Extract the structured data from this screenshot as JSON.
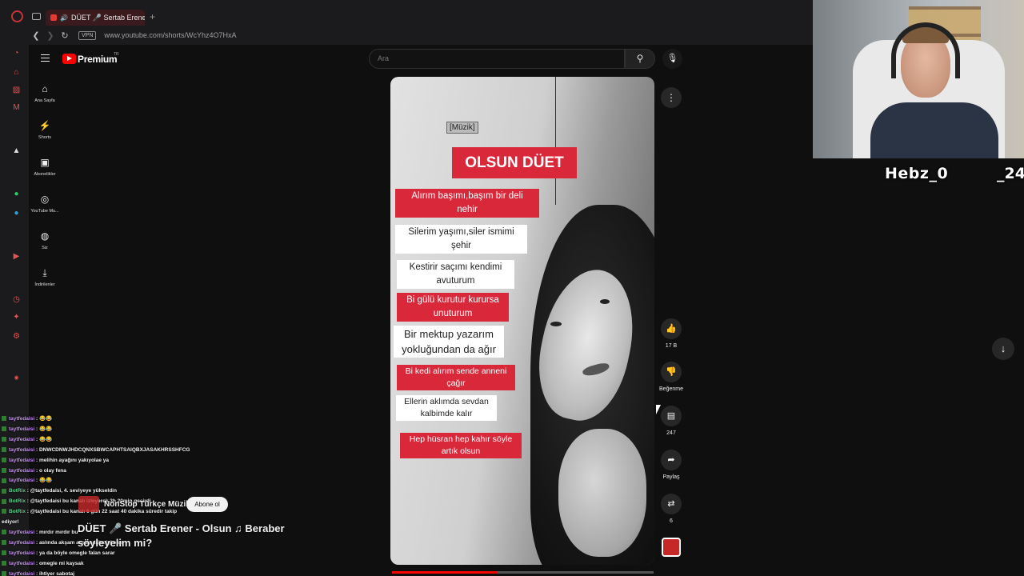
{
  "browser": {
    "tab_title": "DÜET 🎤 Sertab Erener",
    "new_tab_icon": "+",
    "vpn_label": "VPN",
    "url": "www.youtube.com/shorts/WcYhz4O7HxA"
  },
  "youtube": {
    "logo_text": "Premium",
    "region": "TR",
    "search_placeholder": "Ara",
    "nav": [
      {
        "label": "Ana Sayfa",
        "icon": "home-icon"
      },
      {
        "label": "Shorts",
        "icon": "shorts-icon"
      },
      {
        "label": "Abonelikler",
        "icon": "subscriptions-icon"
      },
      {
        "label": "YouTube Mu...",
        "icon": "youtube-music-icon"
      },
      {
        "label": "Siz",
        "icon": "you-icon"
      },
      {
        "label": "İndirilenler",
        "icon": "downloads-icon"
      }
    ]
  },
  "video": {
    "tag": "[Müzik]",
    "title_card": "OLSUN DÜET",
    "lyrics": [
      "Alırım başımı,başım bir deli nehir",
      "Silerim yaşımı,siler ismimi şehir",
      "Kestirir saçımı kendimi avuturum",
      "Bi gülü kurutur kurursa unuturum",
      "Bir mektup yazarım yokluğundan da ağır",
      "Bi kedi alırım sende anneni çağır",
      "Ellerin aklımda sevdan kalbimde kalır",
      "Hep hüsran hep kahır söyle artık olsun"
    ],
    "progress": 0.4
  },
  "actions": {
    "likes": "17 B",
    "dislike_label": "Beğenme",
    "comments": "247",
    "share_label": "Paylaş",
    "remix_count": "6"
  },
  "stream": {
    "streamer_name": "Hebz_0",
    "streamer_suffix": "_24"
  },
  "chat": [
    {
      "user": "taytfedaisi",
      "message": "😂😂",
      "bot": false
    },
    {
      "user": "taytfedaisi",
      "message": "😂😂",
      "bot": false
    },
    {
      "user": "taytfedaisi",
      "message": "😂😂",
      "bot": false
    },
    {
      "user": "taytfedaisi",
      "message": "DNWCDNWJHDCQNXSBWCAPHTSAIQBXJASAKHRSSHFCG",
      "bot": false
    },
    {
      "user": "taytfedaisi",
      "message": "melihin ayağını yakıyolae ya",
      "bot": false
    },
    {
      "user": "taytfedaisi",
      "message": "o olay fena",
      "bot": false
    },
    {
      "user": "taytfedaisi",
      "message": "😂😂",
      "bot": false
    },
    {
      "user": "BotRix",
      "message": "@taytfedaisi, 4. seviyeye yükseldin",
      "bot": true
    },
    {
      "user": "BotRix",
      "message": "@taytfedaisi bu kanalı izleyerek 3h 20min geçirdi",
      "bot": true
    },
    {
      "user": "BotRix",
      "message": "@taytfedaisi bu kanalı 6 gün 22 saat 40 dakika süredir takip",
      "bot": true
    },
    {
      "user": "",
      "message": "ediyor!",
      "bot": false
    },
    {
      "user": "taytfedaisi",
      "message": "mırdır mırdır bu",
      "bot": false
    },
    {
      "user": "taytfedaisi",
      "message": "aslında akşam acsan daha iyi olur",
      "bot": false
    },
    {
      "user": "taytfedaisi",
      "message": "ya da böyle omegle falan sarar",
      "bot": false
    },
    {
      "user": "taytfedaisi",
      "message": "omegle mi kaysak",
      "bot": false
    },
    {
      "user": "taytfedaisi",
      "message": "ihtiyer sabotaj",
      "bot": false
    }
  ],
  "short_info": {
    "channel": "NonStop Türkçe Müzik",
    "subscribe_label": "Abone ol",
    "title": "DÜET 🎤 Sertab Erener - Olsun ♫ Beraber söyleyelim mi?"
  },
  "colors": {
    "accent": "#ff0000",
    "lyric_red": "#d9283a",
    "background": "#0f0f0f"
  }
}
